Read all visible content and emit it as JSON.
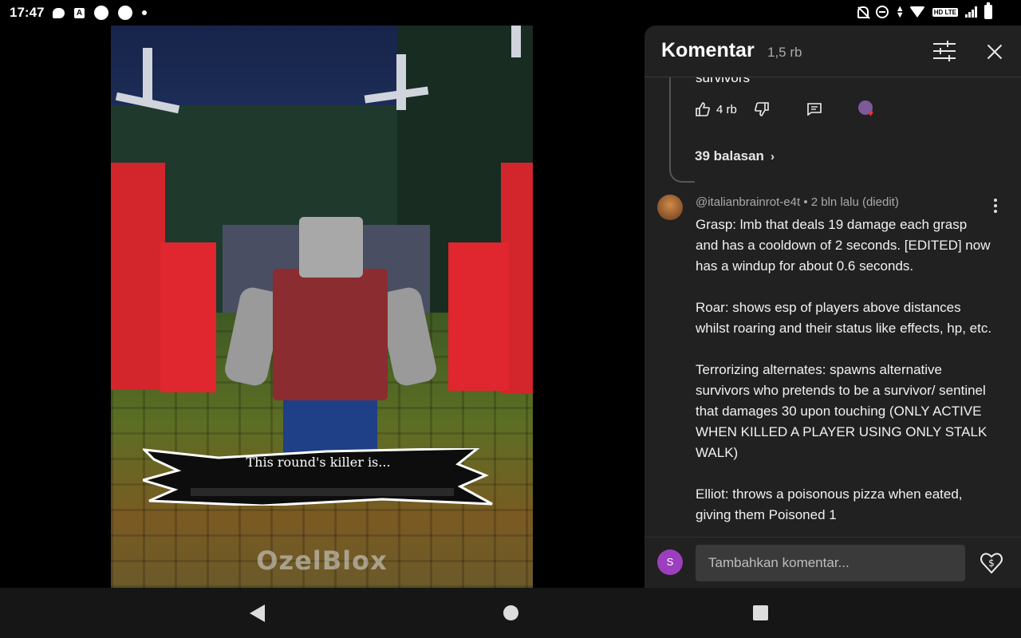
{
  "status_bar": {
    "time": "17:47",
    "left_icons": [
      "chat-bubble-icon",
      "a-icon",
      "circle-icon",
      "circle-icon",
      "dot-icon"
    ],
    "right_icons": [
      "bell-off-icon",
      "dnd-icon",
      "data-arrows-icon",
      "wifi-icon",
      "hd-lte-icon",
      "signal-icon",
      "battery-icon"
    ],
    "network_badge": "HD LTE"
  },
  "video": {
    "banner_text": "This round's killer is...",
    "watermark": "OzelBlox"
  },
  "comments_panel": {
    "title": "Komentar",
    "count": "1,5 rb",
    "truncated_text": "survivors",
    "prev_comment_actions": {
      "like_count": "4 rb"
    },
    "replies_link": "39 balasan",
    "comment": {
      "author": "@italianbrainrot-e4t",
      "meta_separator": "•",
      "time": "2 bln lalu (diedit)",
      "paragraphs": [
        "Grasp: lmb that deals 19 damage each grasp and has a cooldown of 2 seconds.  [EDITED] now has a windup for about 0.6 seconds.",
        "Roar: shows esp of players above distances whilst roaring and their status like effects, hp, etc.",
        "Terrorizing alternates: spawns alternative survivors who pretends to be a survivor/ sentinel that damages 30 upon touching (ONLY ACTIVE WHEN KILLED A PLAYER USING ONLY STALK WALK)",
        "Elliot: throws a poisonous pizza when eated, giving them Poisoned 1"
      ]
    },
    "input": {
      "user_initial": "S",
      "placeholder": "Tambahkan komentar..."
    }
  },
  "colors": {
    "panel_bg": "#212121",
    "avatar_purple": "#9c3fbf",
    "heart_red": "#e53935"
  }
}
